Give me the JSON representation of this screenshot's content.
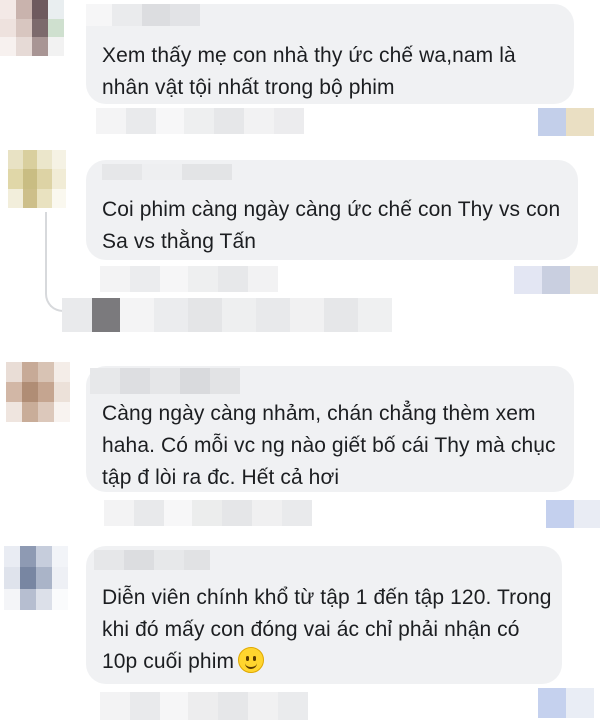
{
  "comments": [
    {
      "text": "Xem thấy mẹ con nhà thy ức chế wa,nam là nhân vật tội nhất trong bộ phim"
    },
    {
      "text": "Coi phim càng ngày càng ức chế con Thy vs con Sa vs thằng Tấn"
    },
    {
      "text": "Càng ngày càng nhảm, chán chẳng thèm xem haha. Có mỗi vc ng nào giết bố cái Thy mà chục tập đ lòi ra đc. Hết cả hơi"
    },
    {
      "text": "Diễn viên chính khổ từ tập 1 đến tập 120. Trong khi đó mấy con đóng vai ác chỉ phải nhận có 10p cuối phim",
      "emoji": "slightly-smiling-face-icon"
    }
  ],
  "colors": {
    "bubble": "#f0f1f3",
    "text": "#1c1e21",
    "thread_line": "#d7d9dc"
  }
}
